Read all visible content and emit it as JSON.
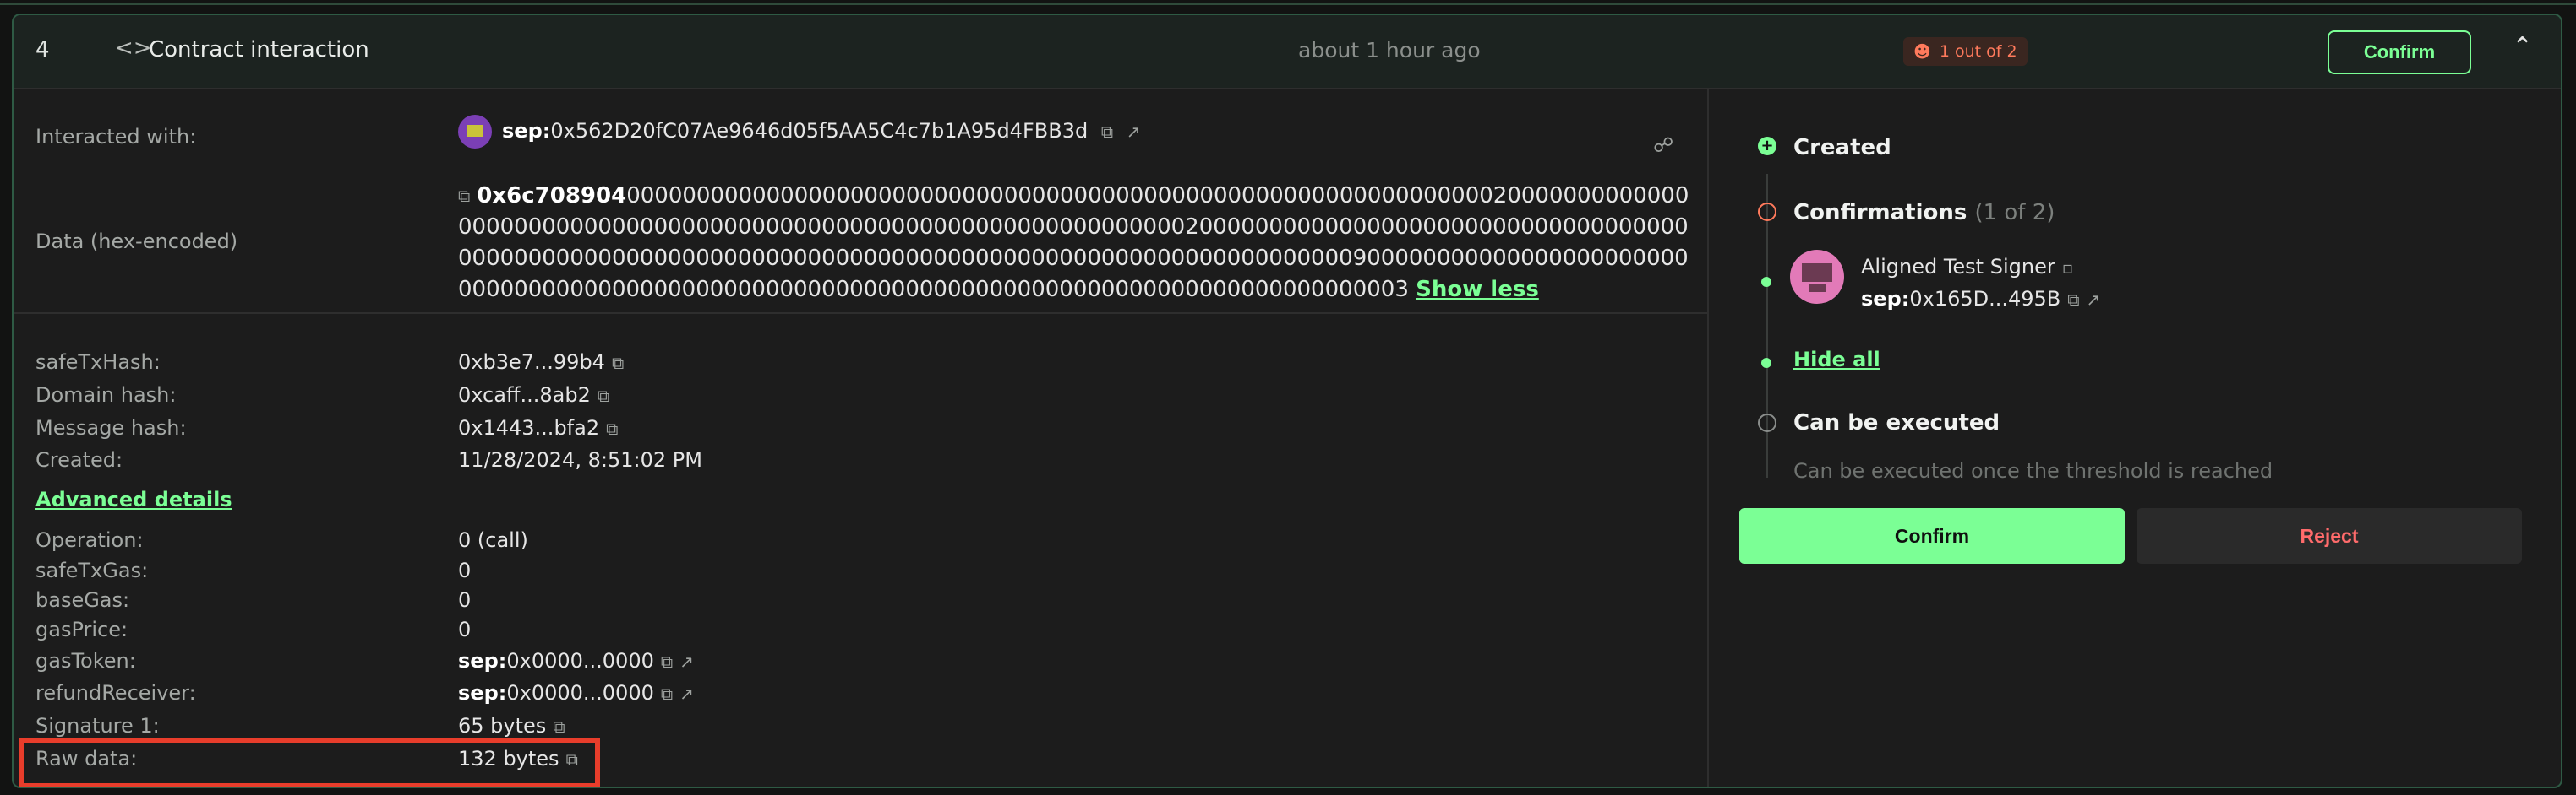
{
  "header": {
    "tx_number": "4",
    "code_icon": "code-icon",
    "title": "Contract interaction",
    "time": "about 1 hour ago",
    "badge": "1 out of 2",
    "confirm_label": "Confirm",
    "chevron_icon": "chevron-up-icon"
  },
  "details": {
    "interacted_label": "Interacted with:",
    "interacted_prefix": "sep:",
    "interacted_address": "0x562D20fC07Ae9646d05f5AA5C4c7b1A95d4FBB3d",
    "data_label": "Data (hex-encoded)",
    "data_selector": "0x6c708904",
    "data_rest": "00000000000000000000000000000000000000000000000000000000000000200000000000000000000000000000000000000000000000000000000000000000200000000000000000000000000000000000000000000000000000000000000000000000000000000000000000000000000090000000000000000000000000000000000000000000000000000000000000000000000000000000000000000003",
    "show_less": "Show less",
    "rows": [
      {
        "label": "safeTxHash:",
        "value": "0xb3e7...99b4"
      },
      {
        "label": "Domain hash:",
        "value": "0xcaff...8ab2"
      },
      {
        "label": "Message hash:",
        "value": "0x1443...bfa2"
      },
      {
        "label": "Created:",
        "value": "11/28/2024, 8:51:02 PM"
      }
    ],
    "advanced_label": "Advanced details",
    "advanced_rows": [
      {
        "label": "Operation:",
        "value": "0 (call)"
      },
      {
        "label": "safeTxGas:",
        "value": "0"
      },
      {
        "label": "baseGas:",
        "value": "0"
      },
      {
        "label": "gasPrice:",
        "value": "0"
      },
      {
        "label": "gasToken:",
        "prefix": "sep:",
        "value": "0x0000...0000"
      },
      {
        "label": "refundReceiver:",
        "prefix": "sep:",
        "value": "0x0000...0000"
      },
      {
        "label": "Signature 1:",
        "value": "65 bytes"
      },
      {
        "label": "Raw data:",
        "value": "132 bytes"
      }
    ]
  },
  "timeline": {
    "created": "Created",
    "confirmations": "Confirmations",
    "confirmations_count": "(1 of 2)",
    "signer_name": "Aligned Test Signer",
    "signer_prefix": "sep:",
    "signer_address": "0x165D...495B",
    "hide_all": "Hide all",
    "can_execute": "Can be executed",
    "execute_note": "Can be executed once the threshold is reached",
    "confirm_button": "Confirm",
    "reject_button": "Reject"
  },
  "colors": {
    "accent": "#7bff95",
    "danger": "#ff6b6b",
    "highlight": "#e83d2b"
  }
}
